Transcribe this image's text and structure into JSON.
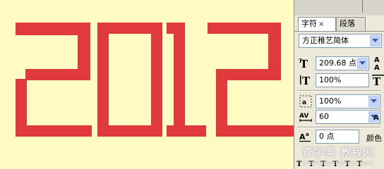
{
  "canvas": {
    "background": "#fffbc3",
    "artwork_text": "2012",
    "artwork_color": "#e03a3e"
  },
  "panel": {
    "tabs": [
      {
        "label": "字符",
        "active": true,
        "close": "×"
      },
      {
        "label": "段落",
        "active": false
      }
    ],
    "font_family": "方正稚艺简体",
    "font_size": "209.68 点",
    "leading_label": "A",
    "vertical_scale": "100%",
    "horizontal_scale": "100%",
    "tracking": "60",
    "baseline_shift": "0 点",
    "color_label": "颜色"
  },
  "watermark": {
    "main": "查字典 教程网",
    "sub": "jiaocheng.chazidian.com"
  }
}
